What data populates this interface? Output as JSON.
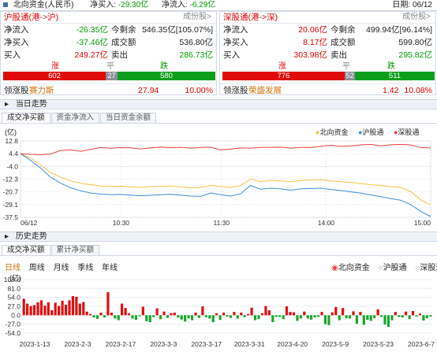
{
  "header": {
    "title": "北向资金(人民币)",
    "net_buy_label": "净买入:",
    "net_buy_value": "-29.30亿",
    "net_in_label": "净流入:",
    "net_in_value": "-6.29亿",
    "date": "日期: 06/12"
  },
  "sh": {
    "title": "沪股通 (沪->沪)",
    "title_display": "沪股通(港->沪)",
    "link": "成份股>",
    "net_in_label": "净流入",
    "net_in": "-26.35亿",
    "remain_label": "今剩余",
    "remain": "546.35亿[105.07%]",
    "net_buy_label": "净买入",
    "net_buy": "-37.46亿",
    "turnover_label": "成交额",
    "turnover": "536.80亿",
    "buy_label": "买入",
    "buy": "249.27亿",
    "sell_label": "卖出",
    "sell": "286.73亿",
    "up_label": "涨",
    "flat_label": "平",
    "down_label": "跌",
    "up": "602",
    "flat": "27",
    "down": "580",
    "lead_label": "领涨股",
    "lead_name": "赛力斯",
    "lead_price": "27.94",
    "lead_pct": "10.00%"
  },
  "sz": {
    "title": "深股通(港->深)",
    "link": "成份股>",
    "net_in_label": "净流入",
    "net_in": "20.06亿",
    "remain_label": "今剩余",
    "remain": "499.94亿[96.14%]",
    "net_buy_label": "净买入",
    "net_buy": "8.17亿",
    "turnover_label": "成交额",
    "turnover": "599.80亿",
    "buy_label": "买入",
    "buy": "303.98亿",
    "sell_label": "卖出",
    "sell": "295.82亿",
    "up_label": "涨",
    "flat_label": "平",
    "down_label": "跌",
    "up": "776",
    "flat": "52",
    "down": "511",
    "lead_label": "领涨股",
    "lead_name": "荣盛发展",
    "lead_price": "1.42",
    "lead_pct": "10.08%"
  },
  "intraday": {
    "section": "当日走势",
    "tabs": [
      "成交净买额",
      "资金净流入",
      "当日资金余额"
    ],
    "unit": "(亿)",
    "legend": [
      "北向资金",
      "沪股通",
      "深股通"
    ],
    "colors": {
      "north": "#f4c242",
      "sh": "#3d8fe0",
      "sz": "#e8423f"
    }
  },
  "history": {
    "section": "历史走势",
    "tabs": [
      "成交净买额",
      "累计净买额"
    ],
    "periods": [
      "日线",
      "周线",
      "月线",
      "季线",
      "年线"
    ],
    "radios": [
      "北向资金",
      "沪股通",
      "深股通"
    ],
    "unit": "(亿)"
  },
  "chart_data": [
    {
      "type": "line",
      "title": "当日走势",
      "ylabel": "(亿)",
      "yticks": [
        "12.8",
        "4.4",
        "-4.0",
        "-12.3",
        "-20.7",
        "-29.1",
        "-37.5"
      ],
      "ylim": [
        -37.5,
        12.8
      ],
      "xticks": [
        "06/12",
        "10:30",
        "11:30",
        "14:00",
        "15:00"
      ],
      "series": [
        {
          "name": "北向资金",
          "values": [
            4.4,
            1.5,
            -3,
            -8,
            -11,
            -13.5,
            -15,
            -16,
            -16.8,
            -17.2,
            -16.9,
            -17.5,
            -17.8,
            -17.3,
            -17,
            -16.8,
            -17.5,
            -18.2,
            -17.9,
            -16.5,
            -17.2,
            -17.8,
            -16.5,
            -12.3,
            -14,
            -13,
            -13.5,
            -14,
            -13.2,
            -13,
            -12.8,
            -13.5,
            -14,
            -14.5,
            -15.2,
            -16,
            -16.5,
            -17.3,
            -17.8,
            -20.5,
            -26,
            -29.3
          ]
        },
        {
          "name": "沪股通",
          "values": [
            4.4,
            0,
            -5,
            -11,
            -15,
            -18,
            -20,
            -21.5,
            -22.2,
            -22.6,
            -22.4,
            -22.9,
            -23.3,
            -23,
            -22.6,
            -22.3,
            -22.9,
            -23.5,
            -23.7,
            -21.5,
            -22.6,
            -23.5,
            -22,
            -16.5,
            -19,
            -18.3,
            -18.8,
            -19.6,
            -18.8,
            -18.5,
            -18.3,
            -19.2,
            -19.8,
            -20.7,
            -21.5,
            -22.7,
            -23.8,
            -25.2,
            -26.2,
            -29.1,
            -33.5,
            -37
          ]
        },
        {
          "name": "深股通",
          "values": [
            4.4,
            4,
            3.8,
            4.2,
            6.5,
            7,
            6,
            7.2,
            8.5,
            8,
            8.4,
            8.3,
            7.5,
            8.3,
            8.8,
            8.4,
            8.6,
            8.1,
            8.5,
            8.7,
            7,
            7.5,
            8.2,
            8.1,
            8.5,
            8.6,
            8.7,
            8.1,
            8.6,
            8.4,
            9.2,
            10,
            9.3,
            9.6,
            10.2,
            10.5,
            9.6,
            10.3,
            10.5,
            10.2,
            8.5,
            8.2
          ]
        }
      ]
    },
    {
      "type": "bar",
      "title": "历史走势",
      "ylabel": "(亿)",
      "yticks": [
        "108.0",
        "81.0",
        "54.0",
        "27.0",
        "0.0",
        "-27.0",
        "-54.0"
      ],
      "ylim": [
        -54,
        108
      ],
      "xticks": [
        "2023-1-13",
        "2023-2-3",
        "2023-2-17",
        "2023-3-3",
        "2023-3-17",
        "2023-3-31",
        "2023-4-20",
        "2023-5-9",
        "2023-5-23",
        "2023-6-7"
      ],
      "values": [
        50,
        35,
        28,
        31,
        39,
        45,
        29,
        39,
        15,
        38,
        28,
        44,
        32,
        45,
        58,
        56,
        35,
        40,
        11,
        4,
        -7,
        -11,
        8,
        -7,
        70,
        8,
        -10,
        -15,
        35,
        22,
        6,
        -10,
        -14,
        -3,
        26,
        -18,
        -21,
        -6,
        21,
        -12,
        11,
        -8,
        6,
        8,
        -7,
        -13,
        -19,
        -9,
        -15,
        8,
        -8,
        27,
        -6,
        -10,
        -21,
        6,
        -14,
        8,
        -4,
        -8,
        10,
        -10,
        8,
        -6,
        4,
        23,
        -15,
        -11,
        6,
        28,
        15,
        -21,
        -5,
        -5,
        -12,
        27,
        10,
        9,
        -17,
        -10,
        11,
        -10,
        -13,
        -7,
        -5,
        10,
        -27,
        -30,
        9,
        25,
        -15,
        22,
        -9,
        -10,
        12,
        -26,
        10,
        -29,
        -14,
        -17,
        -9,
        18,
        -5,
        -28,
        -35,
        -15,
        10,
        -5,
        -7,
        11,
        -12,
        13,
        -4,
        5,
        -16,
        -9,
        -4
      ]
    }
  ]
}
